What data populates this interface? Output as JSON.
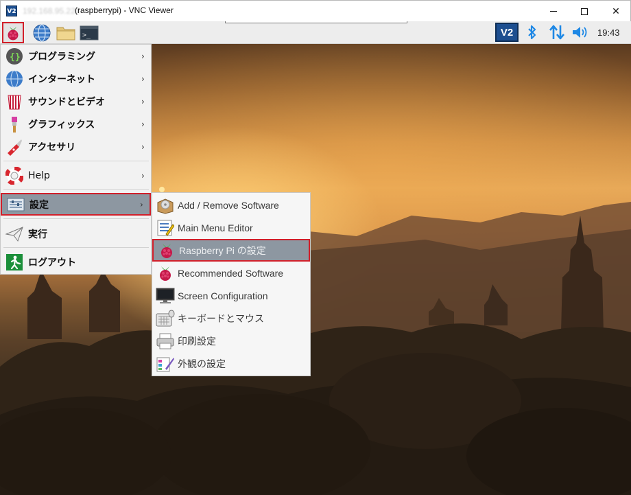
{
  "window": {
    "icon_text": "V2",
    "ip_redacted": "192.168.95.220",
    "title": "(raspberrypi) - VNC Viewer",
    "minimize_icon": "minimize-icon",
    "maximize_icon": "maximize-icon",
    "close_glyph": "✕"
  },
  "panel": {
    "menu_icon": "raspberry-icon",
    "launchers": [
      "globe-icon",
      "folder-icon",
      "terminal-icon"
    ],
    "terminal_glyph": ">_",
    "tray": {
      "vnc_label": "V2",
      "bluetooth_icon": "bluetooth-icon",
      "network_icon": "network-icon",
      "volume_icon": "volume-icon"
    },
    "clock": "19:43"
  },
  "main_menu": {
    "items": [
      {
        "label": "プログラミング",
        "icon": "programming-icon",
        "has_submenu": true
      },
      {
        "label": "インターネット",
        "icon": "globe-icon",
        "has_submenu": true
      },
      {
        "label": "サウンドとビデオ",
        "icon": "sound-video-icon",
        "has_submenu": true
      },
      {
        "label": "グラフィックス",
        "icon": "graphics-brush-icon",
        "has_submenu": true
      },
      {
        "label": "アクセサリ",
        "icon": "accessories-knife-icon",
        "has_submenu": true
      },
      {
        "label": "Help",
        "icon": "help-lifebuoy-icon",
        "has_submenu": true
      },
      {
        "label": "設定",
        "icon": "preferences-icon",
        "has_submenu": true,
        "selected": true
      },
      {
        "label": "実行",
        "icon": "run-paperplane-icon",
        "has_submenu": false
      },
      {
        "label": "ログアウト",
        "icon": "logout-exit-icon",
        "has_submenu": false
      }
    ],
    "arrow_glyph": "›"
  },
  "submenu": {
    "items": [
      {
        "label": "Add / Remove Software",
        "icon": "package-icon"
      },
      {
        "label": "Main Menu Editor",
        "icon": "menu-editor-icon"
      },
      {
        "label": "Raspberry Pi の設定",
        "icon": "raspberry-icon",
        "selected": true
      },
      {
        "label": "Recommended Software",
        "icon": "raspberry-icon"
      },
      {
        "label": "Screen Configuration",
        "icon": "monitor-icon"
      },
      {
        "label": "キーボードとマウス",
        "icon": "keyboard-mouse-icon"
      },
      {
        "label": "印刷設定",
        "icon": "printer-icon"
      },
      {
        "label": "外観の設定",
        "icon": "appearance-icon"
      }
    ]
  },
  "colors": {
    "highlight": "#8d97a1",
    "callout_border": "#d21f2a",
    "vnc_blue": "#1d4f90",
    "tray_blue": "#1e88e5"
  }
}
